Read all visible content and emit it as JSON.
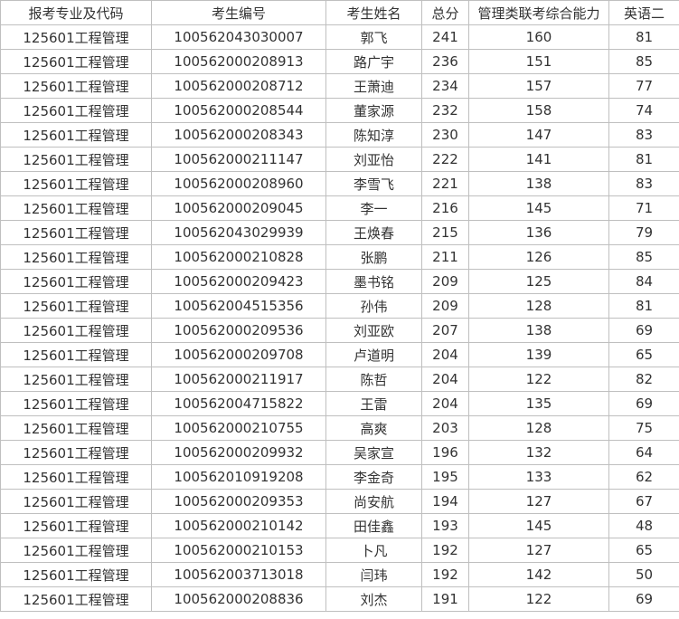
{
  "table": {
    "headers": [
      "报考专业及代码",
      "考生编号",
      "考生姓名",
      "总分",
      "管理类联考综合能力",
      "英语二"
    ],
    "rows": [
      [
        "125601工程管理",
        "100562043030007",
        "郭飞",
        "241",
        "160",
        "81"
      ],
      [
        "125601工程管理",
        "100562000208913",
        "路广宇",
        "236",
        "151",
        "85"
      ],
      [
        "125601工程管理",
        "100562000208712",
        "王萧迪",
        "234",
        "157",
        "77"
      ],
      [
        "125601工程管理",
        "100562000208544",
        "董家源",
        "232",
        "158",
        "74"
      ],
      [
        "125601工程管理",
        "100562000208343",
        "陈知淳",
        "230",
        "147",
        "83"
      ],
      [
        "125601工程管理",
        "100562000211147",
        "刘亚怡",
        "222",
        "141",
        "81"
      ],
      [
        "125601工程管理",
        "100562000208960",
        "李雪飞",
        "221",
        "138",
        "83"
      ],
      [
        "125601工程管理",
        "100562000209045",
        "李一",
        "216",
        "145",
        "71"
      ],
      [
        "125601工程管理",
        "100562043029939",
        "王焕春",
        "215",
        "136",
        "79"
      ],
      [
        "125601工程管理",
        "100562000210828",
        "张鹏",
        "211",
        "126",
        "85"
      ],
      [
        "125601工程管理",
        "100562000209423",
        "墨书铭",
        "209",
        "125",
        "84"
      ],
      [
        "125601工程管理",
        "100562004515356",
        "孙伟",
        "209",
        "128",
        "81"
      ],
      [
        "125601工程管理",
        "100562000209536",
        "刘亚欧",
        "207",
        "138",
        "69"
      ],
      [
        "125601工程管理",
        "100562000209708",
        "卢道明",
        "204",
        "139",
        "65"
      ],
      [
        "125601工程管理",
        "100562000211917",
        "陈哲",
        "204",
        "122",
        "82"
      ],
      [
        "125601工程管理",
        "100562004715822",
        "王雷",
        "204",
        "135",
        "69"
      ],
      [
        "125601工程管理",
        "100562000210755",
        "高爽",
        "203",
        "128",
        "75"
      ],
      [
        "125601工程管理",
        "100562000209932",
        "吴家宣",
        "196",
        "132",
        "64"
      ],
      [
        "125601工程管理",
        "100562010919208",
        "李金奇",
        "195",
        "133",
        "62"
      ],
      [
        "125601工程管理",
        "100562000209353",
        "尚安航",
        "194",
        "127",
        "67"
      ],
      [
        "125601工程管理",
        "100562000210142",
        "田佳鑫",
        "193",
        "145",
        "48"
      ],
      [
        "125601工程管理",
        "100562000210153",
        "卜凡",
        "192",
        "127",
        "65"
      ],
      [
        "125601工程管理",
        "100562003713018",
        "闫玮",
        "192",
        "142",
        "50"
      ],
      [
        "125601工程管理",
        "100562000208836",
        "刘杰",
        "191",
        "122",
        "69"
      ]
    ]
  }
}
